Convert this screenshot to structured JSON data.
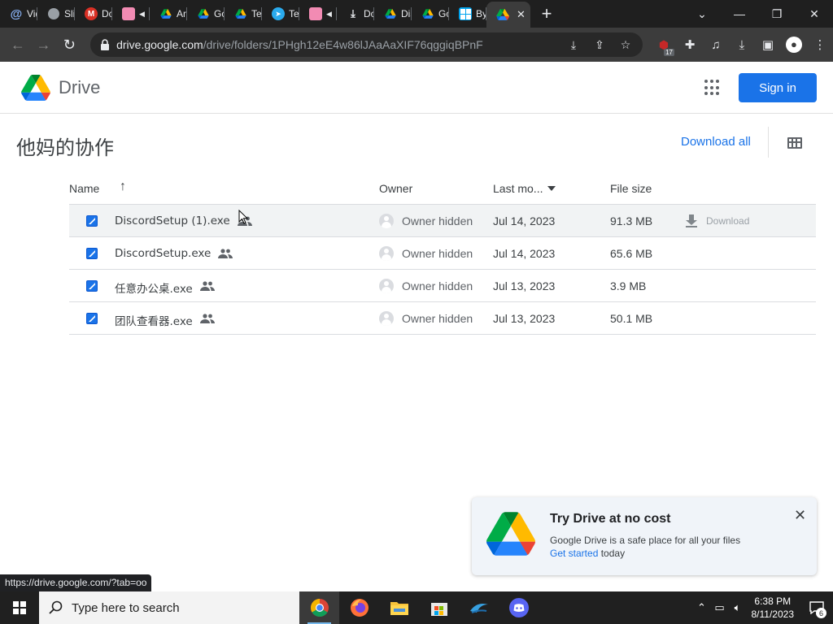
{
  "browser": {
    "tabs": [
      {
        "title": "Vid",
        "icon": "at-icon",
        "color": "#8ab4f8"
      },
      {
        "title": "Slit",
        "icon": "globe-icon",
        "color": "#9aa0a6"
      },
      {
        "title": "Dc",
        "icon": "m-logo-icon",
        "color": "#d93025"
      },
      {
        "title": "",
        "icon": "avatar-icon",
        "color": "#f28bb3",
        "audio": true
      },
      {
        "title": "An",
        "icon": "drive-icon",
        "color": "#34a853"
      },
      {
        "title": "Go",
        "icon": "drive-icon",
        "color": "#34a853"
      },
      {
        "title": "Te",
        "icon": "drive-icon",
        "color": "#34a853"
      },
      {
        "title": "Te",
        "icon": "telegram-icon",
        "color": "#2aabee"
      },
      {
        "title": "",
        "icon": "avatar-icon",
        "color": "#f28bb3",
        "audio": true
      },
      {
        "title": "Dc",
        "icon": "download-icon",
        "color": "#e8eaed"
      },
      {
        "title": "Dis",
        "icon": "drive-icon",
        "color": "#34a853"
      },
      {
        "title": "Go",
        "icon": "drive-icon",
        "color": "#34a853"
      },
      {
        "title": "By",
        "icon": "windows-icon",
        "color": "#00a4ef"
      }
    ],
    "url_host": "drive.google.com",
    "url_path": "/drive/folders/1PHgh12eE4w86lJAaAaXIF76qggiqBPnF",
    "ext_badge": "17"
  },
  "drive": {
    "brand": "Drive",
    "sign_in": "Sign in",
    "folder_title": "他妈的协作",
    "download_all": "Download all",
    "columns": {
      "name": "Name",
      "owner": "Owner",
      "modified": "Last mo...",
      "size": "File size"
    },
    "files": [
      {
        "name": "DiscordSetup (1).exe",
        "owner": "Owner hidden",
        "modified": "Jul 14, 2023",
        "size": "91.3 MB",
        "hover": true,
        "download": "Download"
      },
      {
        "name": "DiscordSetup.exe",
        "owner": "Owner hidden",
        "modified": "Jul 14, 2023",
        "size": "65.6 MB"
      },
      {
        "name": "任意办公桌.exe",
        "owner": "Owner hidden",
        "modified": "Jul 13, 2023",
        "size": "3.9 MB"
      },
      {
        "name": "团队查看器.exe",
        "owner": "Owner hidden",
        "modified": "Jul 13, 2023",
        "size": "50.1 MB"
      }
    ],
    "promo": {
      "title": "Try Drive at no cost",
      "text": "Google Drive is a safe place for all your files",
      "link": "Get started",
      "link_suffix": " today"
    }
  },
  "status_url": "https://drive.google.com/?tab=oo",
  "taskbar": {
    "search_placeholder": "Type here to search",
    "time": "6:38 PM",
    "date": "8/11/2023",
    "notifications": "6"
  }
}
